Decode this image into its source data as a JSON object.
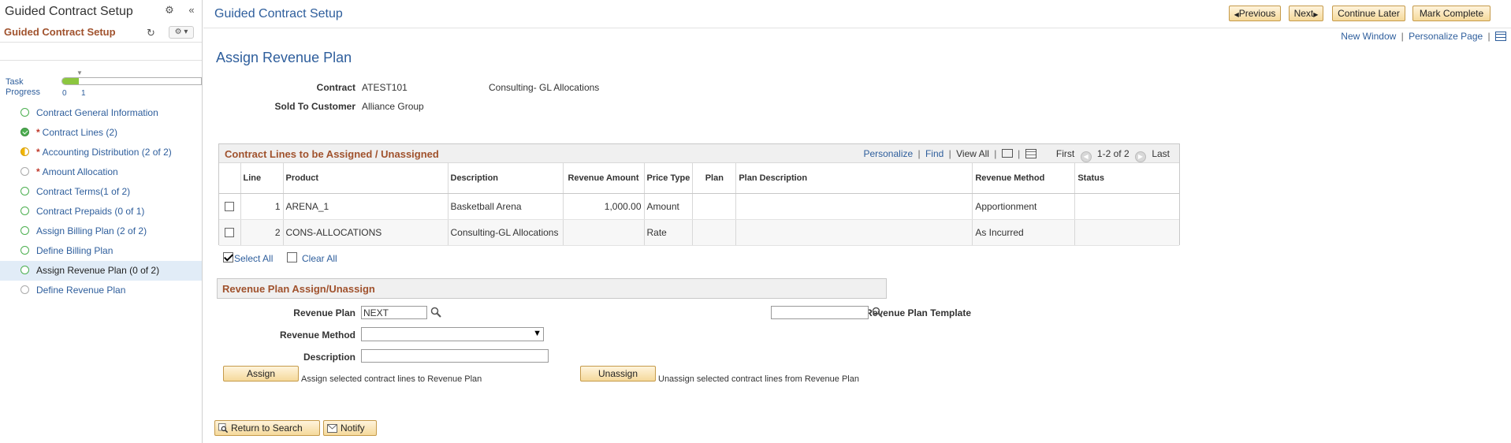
{
  "left_panel": {
    "title": "Guided Contract Setup",
    "subtitle": "Guided Contract Setup",
    "progress": {
      "label": "Task Progress",
      "ticks": [
        "0",
        "1"
      ],
      "fraction": 0.12
    },
    "steps": [
      {
        "label": "Contract General Information",
        "status": "open",
        "required": false,
        "current": false
      },
      {
        "label": "Contract Lines (2)",
        "status": "done",
        "required": true,
        "current": false
      },
      {
        "label": "Accounting Distribution (2 of 2)",
        "status": "half",
        "required": true,
        "current": false
      },
      {
        "label": "Amount Allocation",
        "status": "gray",
        "required": true,
        "current": false
      },
      {
        "label": "Contract Terms(1 of 2)",
        "status": "open",
        "required": false,
        "current": false
      },
      {
        "label": "Contract Prepaids (0 of 1)",
        "status": "open",
        "required": false,
        "current": false
      },
      {
        "label": "Assign Billing Plan (2 of 2)",
        "status": "open",
        "required": false,
        "current": false
      },
      {
        "label": "Define Billing Plan",
        "status": "open",
        "required": false,
        "current": false
      },
      {
        "label": "Assign Revenue Plan (0 of 2)",
        "status": "open",
        "required": false,
        "current": true
      },
      {
        "label": "Define Revenue Plan",
        "status": "gray",
        "required": false,
        "current": false
      }
    ],
    "required_mark": "*"
  },
  "header": {
    "title": "Guided Contract Setup",
    "previous": "Previous",
    "next": "Next",
    "continue_later": "Continue Later",
    "mark_complete": "Mark Complete",
    "new_window": "New Window",
    "personalize_page": "Personalize Page",
    "sep": "|"
  },
  "page": {
    "heading": "Assign Revenue Plan",
    "contract_label": "Contract",
    "contract_id": "ATEST101",
    "contract_desc": "Consulting- GL Allocations",
    "customer_label": "Sold To Customer",
    "customer_value": "Alliance Group"
  },
  "grid": {
    "title": "Contract Lines to be Assigned / Unassigned",
    "personalize": "Personalize",
    "find": "Find",
    "view_all": "View All",
    "first": "First",
    "range": "1-2 of 2",
    "last": "Last",
    "columns": [
      "",
      "Line",
      "Product",
      "Description",
      "Revenue Amount",
      "Price Type",
      "Plan",
      "Plan Description",
      "Revenue Method",
      "Status"
    ],
    "rows": [
      {
        "line": "1",
        "product": "ARENA_1",
        "description": "Basketball Arena",
        "amount": "1,000.00",
        "price_type": "Amount",
        "plan": "",
        "plan_desc": "",
        "method": "Apportionment",
        "status": ""
      },
      {
        "line": "2",
        "product": "CONS-ALLOCATIONS",
        "description": "Consulting-GL Allocations",
        "amount": "",
        "price_type": "Rate",
        "plan": "",
        "plan_desc": "",
        "method": "As Incurred",
        "status": ""
      }
    ],
    "select_all": "Select All",
    "clear_all": "Clear All"
  },
  "assign": {
    "section_title": "Revenue Plan Assign/Unassign",
    "plan_label": "Revenue Plan",
    "plan_value": "NEXT",
    "template_label": "Revenue Plan Template",
    "template_value": "",
    "method_label": "Revenue Method",
    "method_value": "",
    "description_label": "Description",
    "description_value": "",
    "assign_btn": "Assign",
    "assign_hint": "Assign selected contract lines to Revenue Plan",
    "unassign_btn": "Unassign",
    "unassign_hint": "Unassign selected contract lines from Revenue Plan"
  },
  "footer": {
    "return_to_search": "Return to Search",
    "notify": "Notify"
  },
  "colors": {
    "link": "#2e5e9c",
    "section_title": "#a0522d",
    "progress_fill": "#8cc63f",
    "button_border": "#c59a4a"
  }
}
